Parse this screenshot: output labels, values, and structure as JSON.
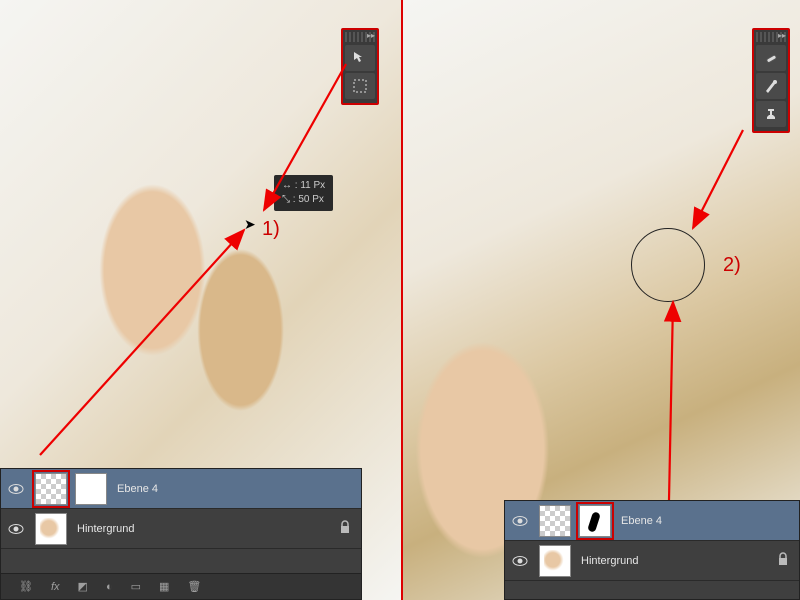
{
  "steps": {
    "left_label": "1)",
    "right_label": "2)"
  },
  "tooltip": {
    "line1": "↔ : 11 Px",
    "line2": "⤡ : 50 Px"
  },
  "toolbars": {
    "left": {
      "tools": [
        "move-tool",
        "marquee-tool"
      ]
    },
    "right": {
      "tools": [
        "healing-brush-tool",
        "brush-tool",
        "clone-stamp-tool"
      ]
    }
  },
  "layers_left": {
    "rows": [
      {
        "name": "Ebene 4",
        "selected": true,
        "has_mask": true,
        "thumb_highlight": "layer"
      },
      {
        "name": "Hintergrund",
        "selected": false,
        "locked": true
      }
    ]
  },
  "layers_right": {
    "rows": [
      {
        "name": "Ebene 4",
        "selected": true,
        "has_mask": true,
        "thumb_highlight": "mask",
        "mask_painted": true
      },
      {
        "name": "Hintergrund",
        "selected": false,
        "locked": true
      }
    ]
  },
  "footer_icons": [
    "link-layers",
    "layer-effects",
    "layer-mask",
    "adjustment-layer",
    "group",
    "new-layer",
    "delete-layer"
  ]
}
